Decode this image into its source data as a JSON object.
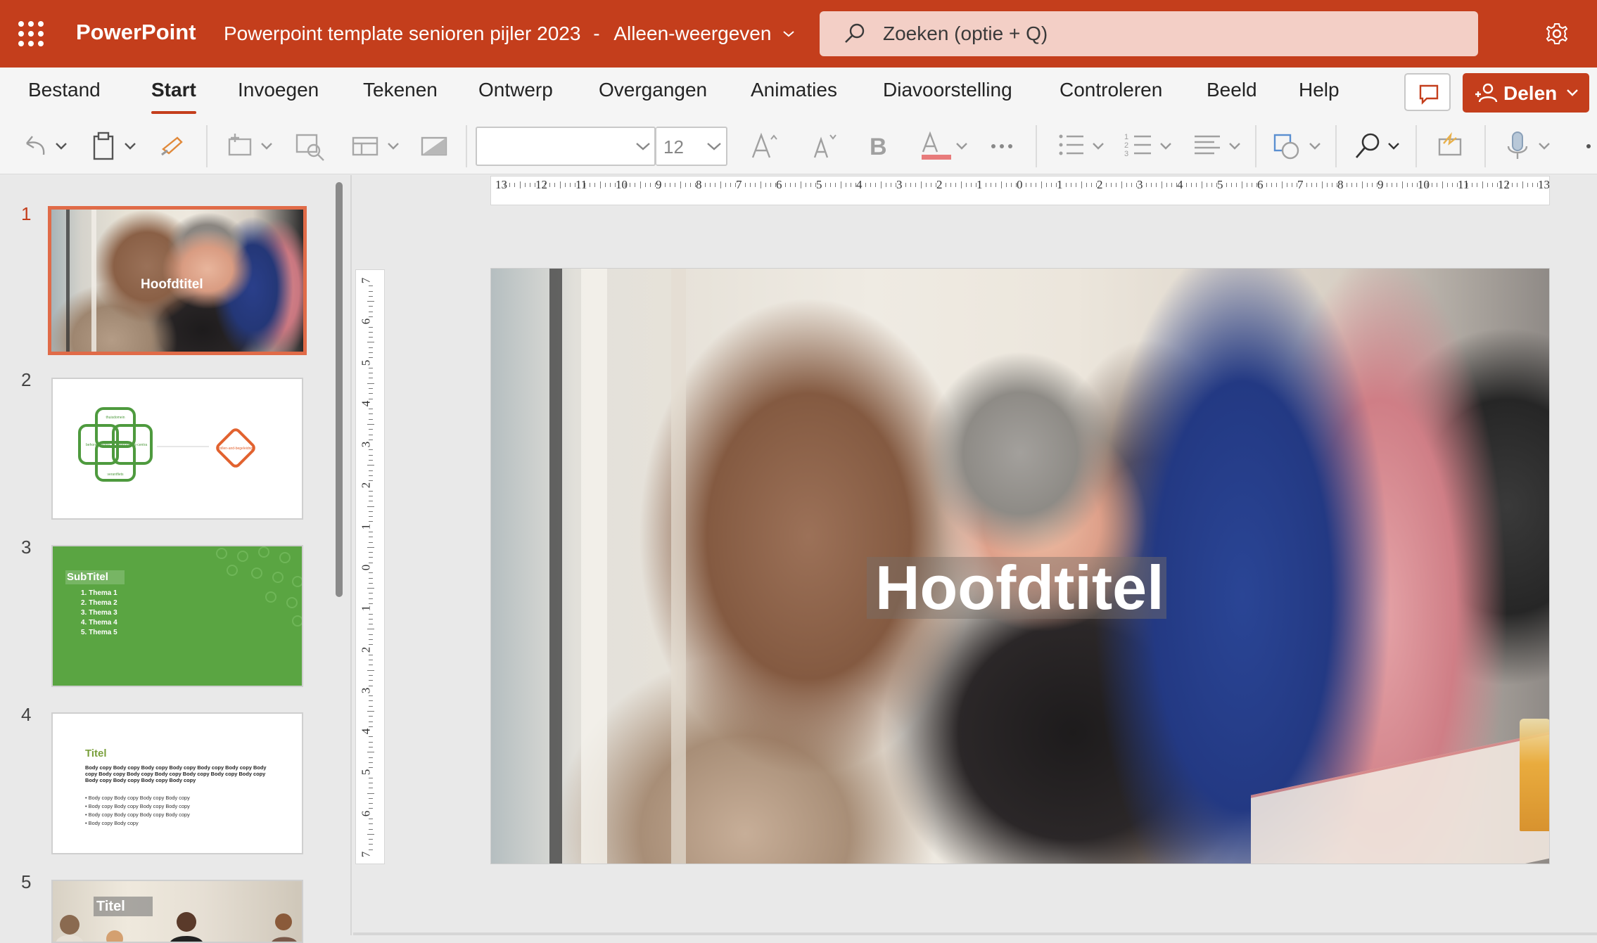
{
  "titlebar": {
    "app_name": "PowerPoint",
    "doc_title": "Powerpoint template senioren pijler 2023",
    "separator": "-",
    "mode": "Alleen-weergeven",
    "search_placeholder": "Zoeken (optie + Q)",
    "background": "#c43e1c"
  },
  "ribbon": {
    "tabs": [
      {
        "label": "Bestand"
      },
      {
        "label": "Start"
      },
      {
        "label": "Invoegen"
      },
      {
        "label": "Tekenen"
      },
      {
        "label": "Ontwerp"
      },
      {
        "label": "Overgangen"
      },
      {
        "label": "Animaties"
      },
      {
        "label": "Diavoorstelling"
      },
      {
        "label": "Controleren"
      },
      {
        "label": "Beeld"
      },
      {
        "label": "Help"
      }
    ],
    "active_tab": "Start",
    "share_label": "Delen"
  },
  "toolbar": {
    "font_name": "",
    "font_size": "12",
    "icons": [
      "undo-icon",
      "paste-icon",
      "format-painter-icon",
      "new-slide-icon",
      "reuse-slides-icon",
      "layout-icon",
      "reset-icon",
      "grow-font-icon",
      "shrink-font-icon",
      "bold-icon",
      "font-color-icon",
      "more-icon",
      "bullets-icon",
      "numbering-icon",
      "align-icon",
      "shapes-icon",
      "find-icon",
      "designer-icon",
      "dictate-icon"
    ],
    "font_color_swatch": "#e87b7b"
  },
  "thumbnails": [
    {
      "number": "1",
      "title": "Hoofdtitel",
      "selected": true
    },
    {
      "number": "2",
      "labels": [
        "thuisdomein",
        "behoren-centra",
        "leeromging-centra",
        "verantfiets",
        "rollen-and-begeleidng"
      ]
    },
    {
      "number": "3",
      "title": "SubTitel",
      "items": [
        "Thema 1",
        "Thema 2",
        "Thema 3",
        "Thema 4",
        "Thema 5"
      ]
    },
    {
      "number": "4",
      "title": "Titel",
      "body": "Body copy Body copy Body copy Body copy Body copy Body copy Body copy Body copy Body copy Body copy Body copy Body copy Body copy Body copy Body copy Body copy Body copy",
      "bullets": [
        "Body copy Body copy Body copy Body copy",
        "Body copy Body copy Body copy Body copy",
        "Body copy Body copy Body copy Body copy",
        "Body copy Body copy"
      ]
    },
    {
      "number": "5",
      "title": "Titel"
    }
  ],
  "rulers": {
    "horizontal": [
      "13",
      "12",
      "11",
      "10",
      "9",
      "8",
      "7",
      "6",
      "5",
      "4",
      "3",
      "2",
      "1",
      "0",
      "1",
      "2",
      "3",
      "4",
      "5",
      "6",
      "7",
      "8",
      "9",
      "10",
      "11",
      "12",
      "13"
    ],
    "vertical": [
      "7",
      "6",
      "5",
      "4",
      "3",
      "2",
      "1",
      "0",
      "1",
      "2",
      "3",
      "4",
      "5",
      "6",
      "7"
    ]
  },
  "slide": {
    "title": "Hoofdtitel"
  },
  "colors": {
    "accent": "#c43e1c",
    "selection": "#e06b48",
    "green_slide": "#5aa542",
    "diagram_green": "#4e9a3e",
    "diagram_orange": "#e2622f"
  }
}
